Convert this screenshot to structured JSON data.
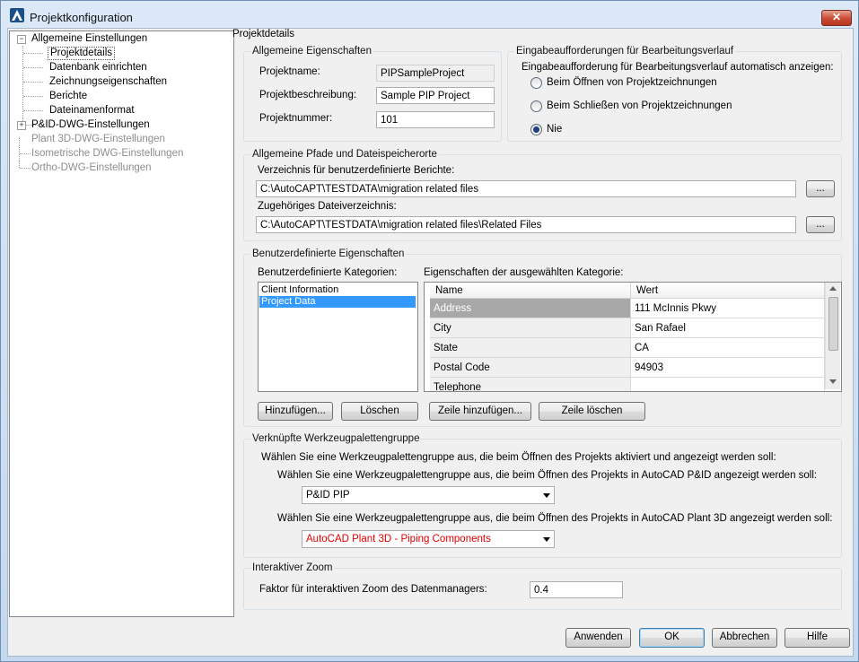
{
  "window": {
    "title": "Projektkonfiguration",
    "close_label": "✕"
  },
  "tree": {
    "items": [
      {
        "label": "Allgemeine Einstellungen",
        "expander": "−"
      },
      {
        "label": "Projektdetails"
      },
      {
        "label": "Datenbank einrichten"
      },
      {
        "label": "Zeichnungseigenschaften"
      },
      {
        "label": "Berichte"
      },
      {
        "label": "Dateinamenformat"
      },
      {
        "label": "P&ID-DWG-Einstellungen",
        "expander": "+"
      },
      {
        "label": "Plant 3D-DWG-Einstellungen"
      },
      {
        "label": "Isometrische DWG-Einstellungen"
      },
      {
        "label": "Ortho-DWG-Einstellungen"
      }
    ]
  },
  "main": {
    "section_title": "Projektdetails",
    "general": {
      "title": "Allgemeine Eigenschaften",
      "name_label": "Projektname:",
      "name_value": "PIPSampleProject",
      "desc_label": "Projektbeschreibung:",
      "desc_value": "Sample PIP Project",
      "number_label": "Projektnummer:",
      "number_value": "101"
    },
    "prompts": {
      "title": "Eingabeaufforderungen für Bearbeitungsverlauf",
      "question": "Eingabeaufforderung für Bearbeitungsverlauf automatisch anzeigen:",
      "options": [
        "Beim Öffnen von Projektzeichnungen",
        "Beim Schließen von Projektzeichnungen",
        "Nie"
      ],
      "selected_index": 2
    },
    "paths": {
      "title": "Allgemeine Pfade und Dateispeicherorte",
      "reports_label": "Verzeichnis für benutzerdefinierte Berichte:",
      "reports_value": "C:\\AutoCAPT\\TESTDATA\\migration related files",
      "related_label": "Zugehöriges Dateiverzeichnis:",
      "related_value": "C:\\AutoCAPT\\TESTDATA\\migration related files\\Related Files",
      "browse_label": "..."
    },
    "custom": {
      "title": "Benutzerdefinierte Eigenschaften",
      "categories_label": "Benutzerdefinierte Kategorien:",
      "categories": [
        "Client Information",
        "Project Data"
      ],
      "selected_category": 1,
      "properties_label": "Eigenschaften der ausgewählten Kategorie:",
      "columns": {
        "name": "Name",
        "value": "Wert"
      },
      "rows": [
        {
          "name": "Address",
          "value": "111 McInnis Pkwy"
        },
        {
          "name": "City",
          "value": "San Rafael"
        },
        {
          "name": "State",
          "value": "CA"
        },
        {
          "name": "Postal Code",
          "value": "94903"
        },
        {
          "name": "Telephone",
          "value": ""
        }
      ],
      "add_label": "Hinzufügen...",
      "delete_label": "Löschen",
      "add_row_label": "Zeile hinzufügen...",
      "delete_row_label": "Zeile löschen"
    },
    "palette": {
      "title": "Verknüpfte Werkzeugpalettengruppe",
      "intro": "Wählen Sie eine Werkzeugpalettengruppe aus, die beim Öffnen des Projekts aktiviert und angezeigt werden soll:",
      "pid_label": "Wählen Sie eine Werkzeugpalettengruppe aus, die beim Öffnen des Projekts in AutoCAD P&ID angezeigt werden soll:",
      "pid_value": "P&ID PIP",
      "plant_label": "Wählen Sie eine Werkzeugpalettengruppe aus, die beim Öffnen des Projekts in AutoCAD Plant 3D angezeigt werden soll:",
      "plant_value": "AutoCAD Plant 3D - Piping Components",
      "plant_value_color": "#e00000"
    },
    "zoom": {
      "title": "Interaktiver Zoom",
      "label": "Faktor für interaktiven Zoom des Datenmanagers:",
      "value": "0.4"
    }
  },
  "footer": {
    "apply": "Anwenden",
    "ok": "OK",
    "cancel": "Abbrechen",
    "help": "Hilfe"
  }
}
